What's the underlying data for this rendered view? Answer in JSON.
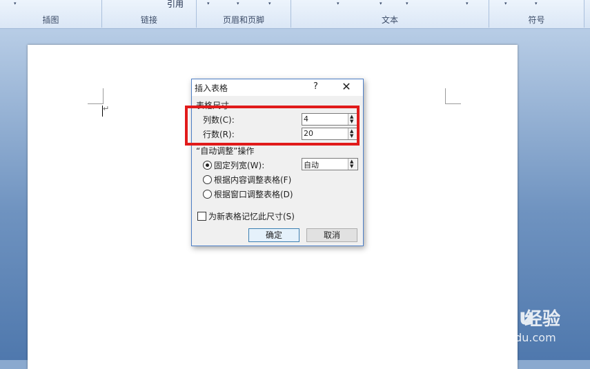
{
  "ribbon": {
    "groups": [
      {
        "label": "插图",
        "top_text": ""
      },
      {
        "label": "链接",
        "top_text": "引用"
      },
      {
        "label": "页眉和页脚",
        "top_text": ""
      },
      {
        "label": "文本",
        "top_text": ""
      },
      {
        "label": "符号",
        "top_text": ""
      }
    ],
    "arrow": "▾"
  },
  "dialog": {
    "title": "插入表格",
    "help": "?",
    "close": "✕",
    "section_size": "表格尺寸",
    "columns_label": "列数(C):",
    "columns_value": "4",
    "rows_label": "行数(R):",
    "rows_value": "20",
    "section_autofit": "“自动调整”操作",
    "fixed_width_label": "固定列宽(W):",
    "fixed_width_value": "自动",
    "autofit_content_label": "根据内容调整表格(F)",
    "autofit_window_label": "根据窗口调整表格(D)",
    "remember_label": "为新表格记忆此尺寸(S)",
    "ok_label": "确定",
    "cancel_label": "取消",
    "spin_up": "▲",
    "spin_down": "▼"
  },
  "watermark": {
    "brand": "Bai du",
    "jingyan": "经验",
    "url": "jingyan.baidu.com"
  },
  "colors": {
    "highlight": "#e11b1b",
    "dialog_border": "#4c7ec6"
  }
}
